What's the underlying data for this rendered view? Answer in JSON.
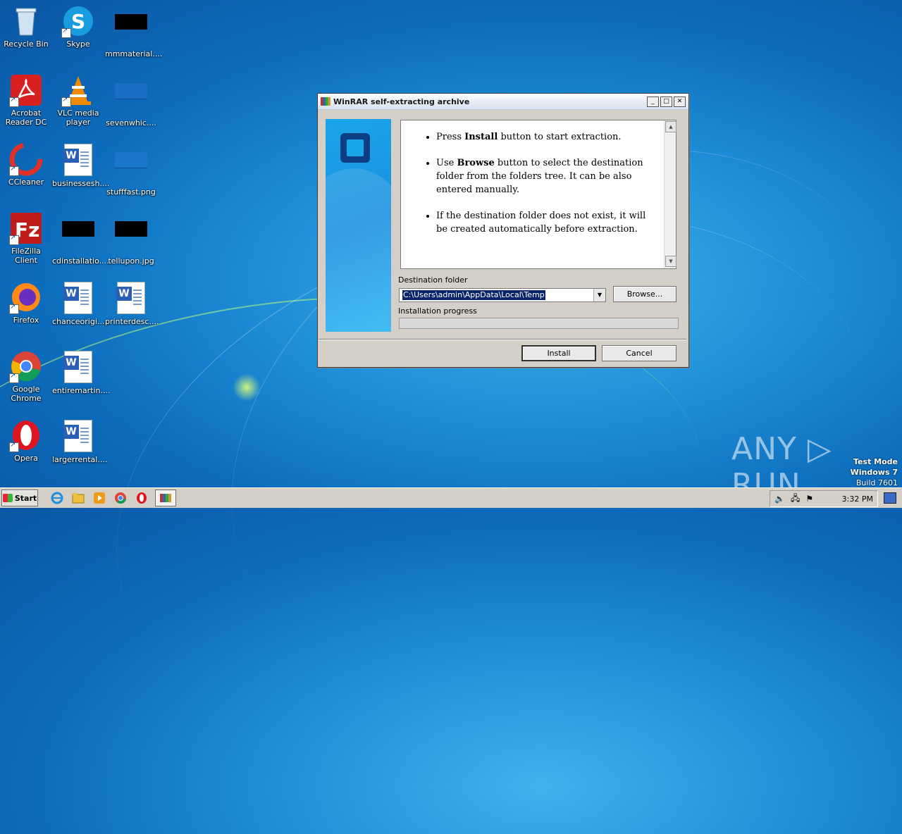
{
  "desktop": {
    "icons": [
      {
        "label": "Recycle Bin",
        "icon": "recycle-bin-icon"
      },
      {
        "label": "Skype",
        "icon": "skype-icon"
      },
      {
        "label": "mmmaterial....",
        "icon": "image-file-icon"
      },
      {
        "label": "Acrobat Reader DC",
        "icon": "acrobat-icon"
      },
      {
        "label": "VLC media player",
        "icon": "vlc-icon"
      },
      {
        "label": "sevenwhic....",
        "icon": "image-file-icon"
      },
      {
        "label": "CCleaner",
        "icon": "ccleaner-icon"
      },
      {
        "label": "businessesh....",
        "icon": "word-doc-icon"
      },
      {
        "label": "stufffast.png",
        "icon": "image-file-icon"
      },
      {
        "label": "FileZilla Client",
        "icon": "filezilla-icon"
      },
      {
        "label": "cdinstallatio....",
        "icon": "image-file-icon"
      },
      {
        "label": "tellupon.jpg",
        "icon": "image-file-icon"
      },
      {
        "label": "Firefox",
        "icon": "firefox-icon"
      },
      {
        "label": "chanceorigi....",
        "icon": "word-doc-icon"
      },
      {
        "label": "printerdesc....",
        "icon": "word-doc-icon"
      },
      {
        "label": "Google Chrome",
        "icon": "chrome-icon"
      },
      {
        "label": "entiremartin....",
        "icon": "word-doc-icon"
      },
      {
        "label": "Opera",
        "icon": "opera-icon"
      },
      {
        "label": "largerrental....",
        "icon": "word-doc-icon"
      }
    ]
  },
  "dialog": {
    "title": "WinRAR self-extracting archive",
    "controls": {
      "minimize": "_",
      "maximize": "□",
      "close": "✕"
    },
    "bullets": [
      {
        "prefix": "Press ",
        "bold": "Install",
        "suffix": " button to start extraction."
      },
      {
        "prefix": "Use ",
        "bold": "Browse",
        "suffix": " button to select the destination folder from the folders tree. It can be also entered manually."
      },
      {
        "prefix": "",
        "bold": "",
        "suffix": "If the destination folder does not exist, it will be created automatically before extraction."
      }
    ],
    "dest_label": "Destination folder",
    "dest_value": "C:\\Users\\admin\\AppData\\Local\\Temp",
    "browse_label": "Browse...",
    "progress_label": "Installation progress",
    "progress_value": 0,
    "install_label": "Install",
    "cancel_label": "Cancel"
  },
  "watermark": {
    "text": "ANY ▷ RUN"
  },
  "testmode": {
    "line1": "Test Mode",
    "line2": "Windows 7",
    "line3": "Build 7601"
  },
  "taskbar": {
    "start_label": "Start",
    "clock": "3:32 PM"
  }
}
